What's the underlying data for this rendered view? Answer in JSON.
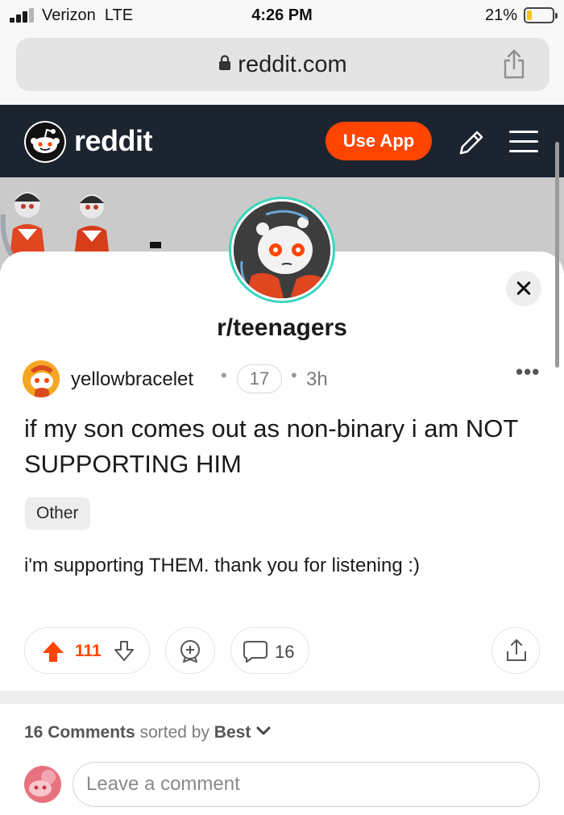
{
  "status_bar": {
    "carrier": "Verizon",
    "network": "LTE",
    "time": "4:26 PM",
    "battery_percent": "21%",
    "battery_level": 0.21,
    "signal_bars_active": 3,
    "signal_bars_total": 4
  },
  "browser": {
    "url": "reddit.com",
    "lock_icon": "lock-icon",
    "share_icon": "share-icon"
  },
  "header": {
    "logo_text": "reddit",
    "use_app_label": "Use App",
    "icons": [
      "pencil-icon",
      "hamburger-menu-icon"
    ]
  },
  "subreddit": {
    "name": "r/teenagers"
  },
  "post": {
    "author": "yellowbracelet",
    "separator": "•",
    "flair_count": "17",
    "age": "3h",
    "more_label": "•••",
    "title": "if my son comes out as non-binary i am NOT SUPPORTING HIM",
    "tag": "Other",
    "body": "i'm supporting THEM. thank you for listening :)",
    "score": "111",
    "comment_count": "16"
  },
  "comments": {
    "count_label": "16 Comments",
    "sorted_by_label": "sorted by",
    "sort_value": "Best",
    "input_placeholder": "Leave a comment"
  },
  "colors": {
    "reddit_orange": "#ff4500",
    "header_bg": "#1c2430",
    "avatar_ring": "#3ad6bd"
  }
}
